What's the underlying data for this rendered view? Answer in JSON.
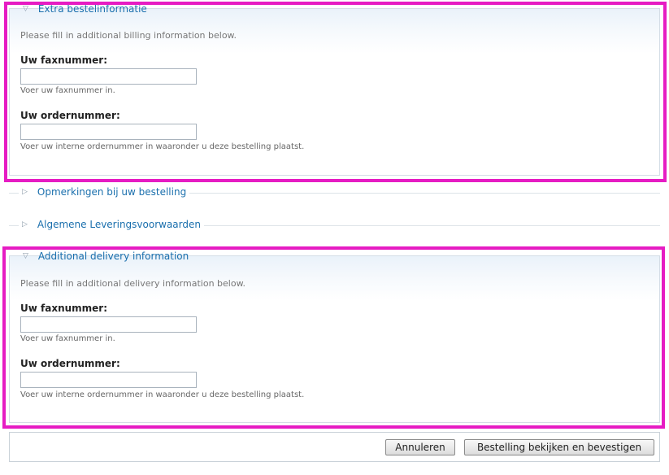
{
  "billing": {
    "title": "Extra bestelinformatie",
    "intro": "Please fill in additional billing information below.",
    "fax_label": "Uw faxnummer:",
    "fax_value": "",
    "fax_desc": "Voer uw faxnummer in.",
    "order_label": "Uw ordernummer:",
    "order_value": "",
    "order_desc": "Voer uw interne ordernummer in waaronder u deze bestelling plaatst."
  },
  "comments": {
    "title": "Opmerkingen bij uw bestelling"
  },
  "terms": {
    "title": "Algemene Leveringsvoorwaarden"
  },
  "delivery": {
    "title": "Additional delivery information",
    "intro": "Please fill in additional delivery information below.",
    "fax_label": "Uw faxnummer:",
    "fax_value": "",
    "fax_desc": "Voer uw faxnummer in.",
    "order_label": "Uw ordernummer:",
    "order_value": "",
    "order_desc": "Voer uw interne ordernummer in waaronder u deze bestelling plaatst."
  },
  "icons": {
    "expanded": "▽",
    "collapsed": "▷"
  },
  "actions": {
    "cancel_label": "Annuleren",
    "confirm_label": "Bestelling bekijken en bevestigen"
  },
  "colors": {
    "highlight": "#e61cc3",
    "legend_link": "#1a6fad"
  }
}
